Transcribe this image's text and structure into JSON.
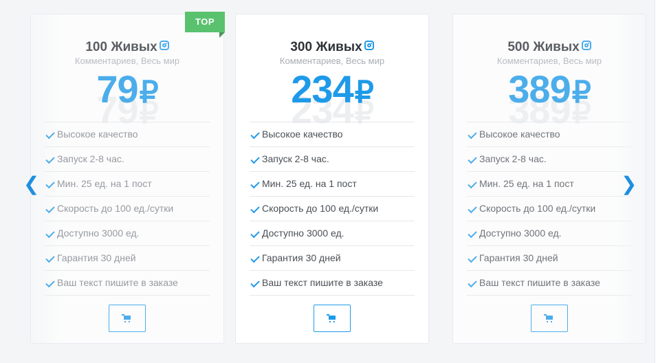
{
  "cards": [
    {
      "title": "100 Живых",
      "subtitle": "Комментариев, Весь мир",
      "price": "79",
      "currency": "₽",
      "badge": "TOP",
      "features": [
        "Высокое качество",
        "Запуск 2-8 час.",
        "Мин. 25 ед. на 1 пост",
        "Скорость до 100 ед./сутки",
        "Доступно 3000 ед.",
        "Гарантия 30 дней",
        "Ваш текст пишите в заказе"
      ]
    },
    {
      "title": "300 Живых",
      "subtitle": "Комментариев, Весь мир",
      "price": "234",
      "currency": "₽",
      "features": [
        "Высокое качество",
        "Запуск 2-8 час.",
        "Мин. 25 ед. на 1 пост",
        "Скорость до 100 ед./сутки",
        "Доступно 3000 ед.",
        "Гарантия 30 дней",
        "Ваш текст пишите в заказе"
      ]
    },
    {
      "title": "500 Живых",
      "subtitle": "Комментариев, Весь мир",
      "price": "389",
      "currency": "₽",
      "features": [
        "Высокое качество",
        "Запуск 2-8 час.",
        "Мин. 25 ед. на 1 пост",
        "Скорость до 100 ед./сутки",
        "Доступно 3000 ед.",
        "Гарантия 30 дней",
        "Ваш текст пишите в заказе"
      ]
    }
  ],
  "nav": {
    "prev_glyph": "❮",
    "next_glyph": "❯"
  },
  "icons": {
    "title_icon": "instagram-icon",
    "feature_icon": "check-icon",
    "button_icon": "cart-icon"
  },
  "colors": {
    "accent": "#1e9ae8",
    "badge": "#2fb44a",
    "text": "#2f3337",
    "muted": "#a9adb3"
  }
}
